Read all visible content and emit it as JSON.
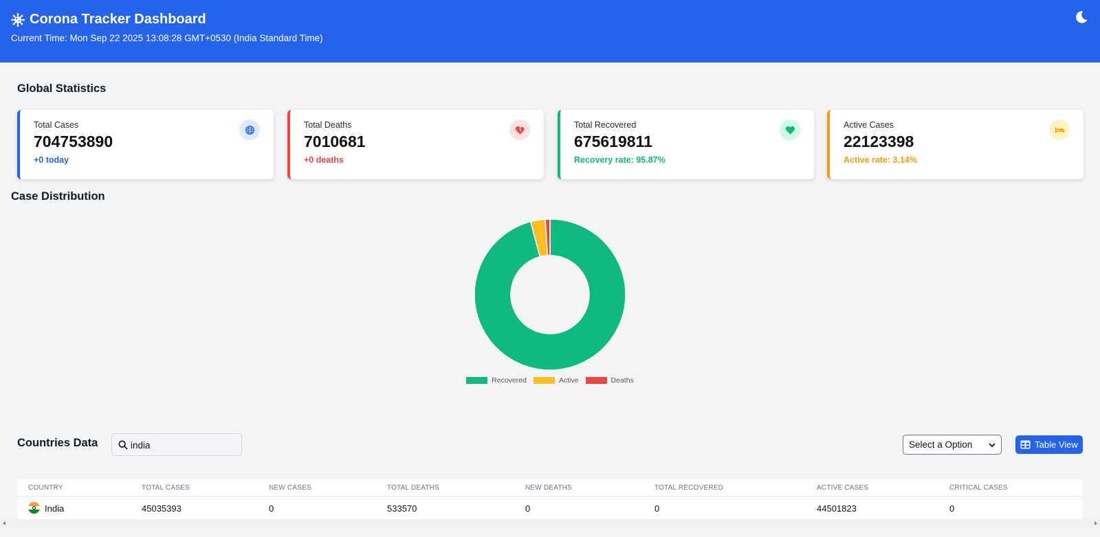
{
  "header": {
    "title": "Corona Tracker Dashboard",
    "time": "Current Time: Mon Sep 22 2025 13:08:28 GMT+0530 (India Standard Time)",
    "icons": {
      "logo": "virus-icon",
      "theme": "moon-icon"
    }
  },
  "global": {
    "title": "Global Statistics",
    "cards": [
      {
        "label": "Total Cases",
        "value": "704753890",
        "sub": "+0 today",
        "color": "#2563eb",
        "icon": "globe-icon",
        "icon_bg": "#dbeafe"
      },
      {
        "label": "Total Deaths",
        "value": "7010681",
        "sub": "+0 deaths",
        "color": "#ef4444",
        "icon": "heart-crack-icon",
        "icon_bg": "#fee2e2"
      },
      {
        "label": "Total Recovered",
        "value": "675619811",
        "sub": "Recovery rate: 95.87%",
        "color": "#10b981",
        "icon": "heart-icon",
        "icon_bg": "#d1fae5"
      },
      {
        "label": "Active Cases",
        "value": "22123398",
        "sub": "Active rate: 3.14%",
        "color": "#f59e0b",
        "icon": "bed-icon",
        "icon_bg": "#fef3c7"
      }
    ]
  },
  "distribution": {
    "title": "Case Distribution"
  },
  "chart_data": {
    "type": "pie",
    "categories": [
      "Recovered",
      "Active",
      "Deaths"
    ],
    "values": [
      675619811,
      22123398,
      7010681
    ],
    "colors": [
      "#10b981",
      "#fbbf24",
      "#ef4444"
    ],
    "donut": true,
    "legend": "bottom"
  },
  "countries": {
    "title": "Countries Data",
    "search_value": "india",
    "select_label": "Select a Option",
    "table_view_label": "Table View",
    "columns": [
      "Country",
      "Total Cases",
      "New Cases",
      "Total Deaths",
      "New Deaths",
      "Total Recovered",
      "Active Cases",
      "Critical Cases"
    ],
    "rows": [
      {
        "country": "India",
        "total_cases": "45035393",
        "new_cases": "0",
        "total_deaths": "533570",
        "new_deaths": "0",
        "total_recovered": "0",
        "active_cases": "44501823",
        "critical_cases": "0"
      }
    ]
  }
}
